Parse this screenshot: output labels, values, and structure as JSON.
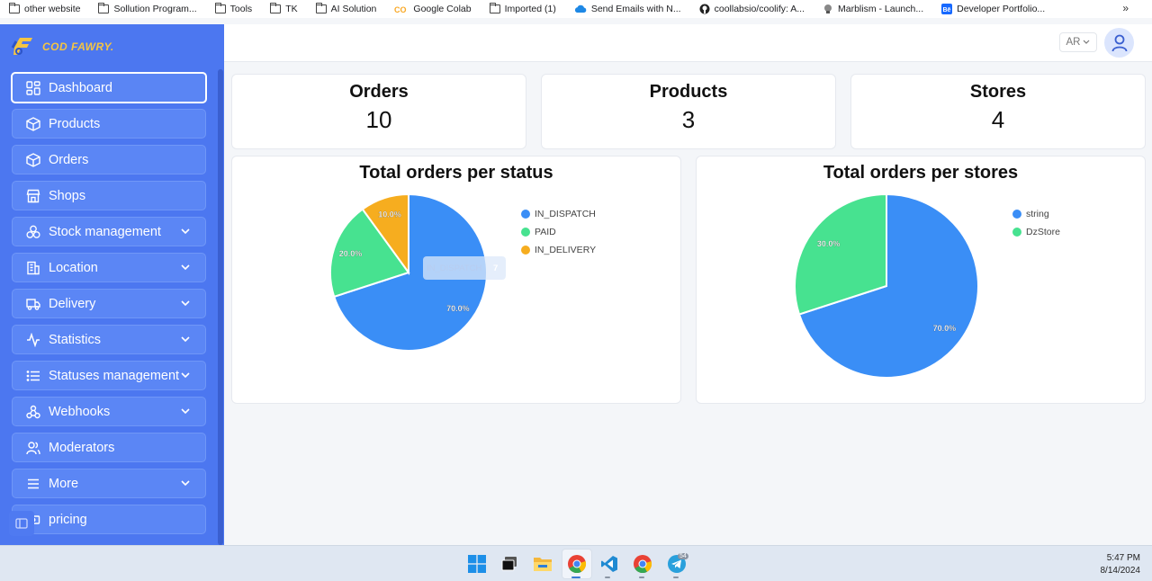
{
  "bookmarks": [
    {
      "label": "other website",
      "icon": "folder-icon"
    },
    {
      "label": "Sollution Program...",
      "icon": "folder-icon"
    },
    {
      "label": "Tools",
      "icon": "folder-icon"
    },
    {
      "label": "TK",
      "icon": "folder-icon"
    },
    {
      "label": "AI Solution",
      "icon": "folder-icon"
    },
    {
      "label": "Google Colab",
      "icon": "colab-icon"
    },
    {
      "label": "Imported (1)",
      "icon": "folder-icon"
    },
    {
      "label": "Send Emails with N...",
      "icon": "cloud-icon"
    },
    {
      "label": "coollabsio/coolify: A...",
      "icon": "github-icon"
    },
    {
      "label": "Marblism - Launch...",
      "icon": "marblism-icon"
    },
    {
      "label": "Developer Portfolio...",
      "icon": "behance-icon"
    }
  ],
  "bookmarks_overflow": "»",
  "brand": {
    "name": "COD FAWRY."
  },
  "sidebar": {
    "items": [
      {
        "label": "Dashboard",
        "icon": "dashboard-icon",
        "active": true,
        "expandable": false
      },
      {
        "label": "Products",
        "icon": "box-icon",
        "expandable": false
      },
      {
        "label": "Orders",
        "icon": "box-icon",
        "expandable": false
      },
      {
        "label": "Shops",
        "icon": "store-icon",
        "expandable": false
      },
      {
        "label": "Stock management",
        "icon": "boxes-icon",
        "expandable": true
      },
      {
        "label": "Location",
        "icon": "building-icon",
        "expandable": true
      },
      {
        "label": "Delivery",
        "icon": "truck-icon",
        "expandable": true
      },
      {
        "label": "Statistics",
        "icon": "activity-icon",
        "expandable": true
      },
      {
        "label": "Statuses management",
        "icon": "list-icon",
        "expandable": true
      },
      {
        "label": "Webhooks",
        "icon": "webhook-icon",
        "expandable": true
      },
      {
        "label": "Moderators",
        "icon": "users-icon",
        "expandable": false
      },
      {
        "label": "More",
        "icon": "menu-icon",
        "expandable": true
      },
      {
        "label": "pricing",
        "icon": "pricing-icon",
        "expandable": false
      }
    ]
  },
  "header": {
    "language": "AR"
  },
  "stats": [
    {
      "title": "Orders",
      "value": "10"
    },
    {
      "title": "Products",
      "value": "3"
    },
    {
      "title": "Stores",
      "value": "4"
    }
  ],
  "colors": {
    "accent": "#4c77f0",
    "blue": "#3a8ef6",
    "green": "#47e290",
    "orange": "#f6ad1f"
  },
  "chart_data": [
    {
      "type": "pie",
      "title": "Total orders per status",
      "labels": [
        "IN_DISPATCH",
        "PAID",
        "IN_DELIVERY"
      ],
      "values": [
        7,
        2,
        1
      ],
      "percent_labels": [
        "70.0%",
        "20.0%",
        "10.0%"
      ],
      "colors": [
        "#3a8ef6",
        "#47e290",
        "#f6ad1f"
      ],
      "legend": "right",
      "tooltip": {
        "label": "IN_DISPATCH",
        "value": "7"
      }
    },
    {
      "type": "pie",
      "title": "Total orders per stores",
      "labels": [
        "string",
        "DzStore"
      ],
      "values": [
        7,
        3
      ],
      "percent_labels": [
        "70.0%",
        "30.0%"
      ],
      "colors": [
        "#3a8ef6",
        "#47e290"
      ],
      "legend": "right"
    }
  ],
  "taskbar": {
    "apps": [
      "windows-start-icon",
      "task-view-icon",
      "file-explorer-icon",
      "chrome-icon",
      "vscode-icon",
      "chrome-profile-icon",
      "telegram-icon"
    ],
    "telegram_badge": "54",
    "time": "5:47 PM",
    "date": "8/14/2024"
  }
}
